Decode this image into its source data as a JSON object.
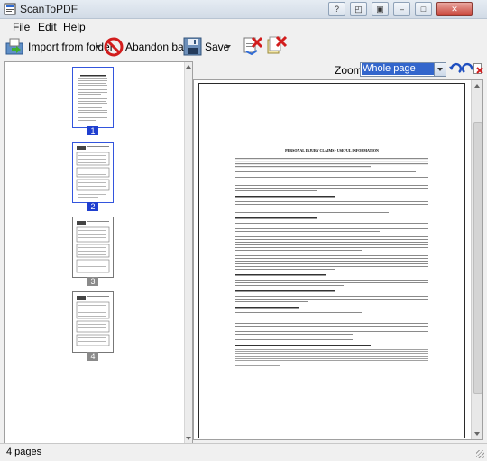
{
  "window": {
    "title": "ScanToPDF"
  },
  "menu": {
    "items": [
      "File",
      "Edit",
      "Help"
    ]
  },
  "toolbar": {
    "import_label": "Import from folder",
    "abandon_label": "Abandon batch",
    "save_label": "Save"
  },
  "zoom": {
    "label": "Zoom:",
    "value": "Whole page"
  },
  "thumbnails": [
    {
      "number": "1",
      "selected": true
    },
    {
      "number": "2",
      "selected": true
    },
    {
      "number": "3",
      "selected": false
    },
    {
      "number": "4",
      "selected": false
    }
  ],
  "document": {
    "heading": "PERSONAL INJURY CLAIMS - USEFUL INFORMATION"
  },
  "status": {
    "pages": "4 pages"
  },
  "colors": {
    "accent": "#1f3fcf",
    "selection": "#3366cc"
  }
}
